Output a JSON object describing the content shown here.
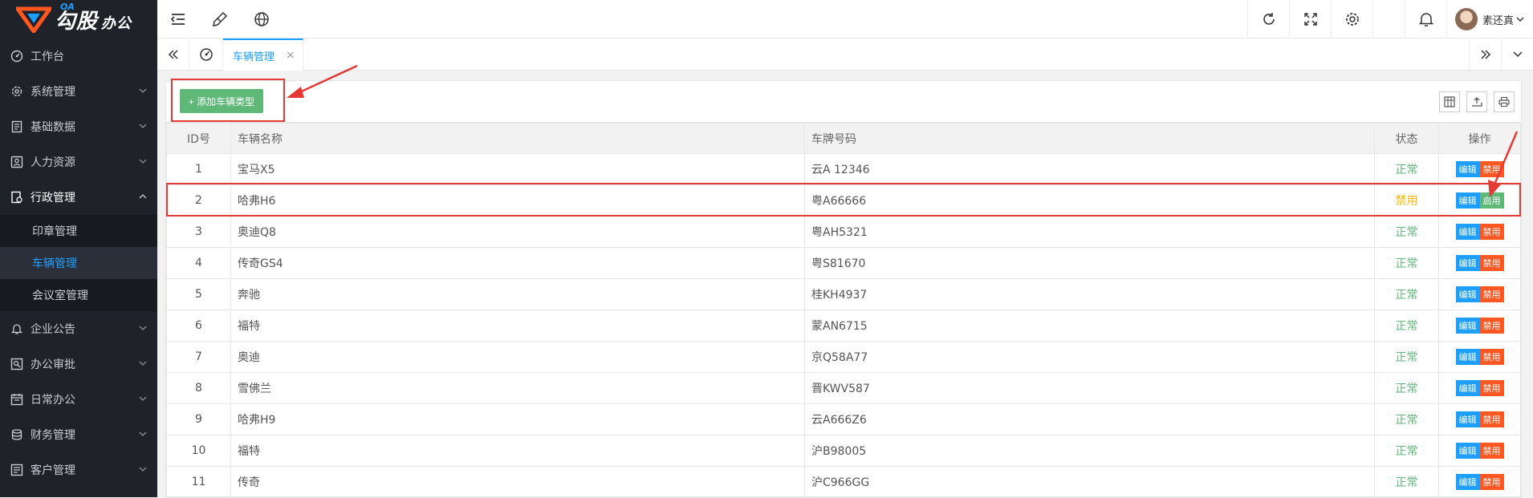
{
  "brand": {
    "oa": "OA",
    "name": "勾股",
    "suffix": "办公"
  },
  "sidebar": {
    "items": [
      {
        "label": "工作台",
        "icon": "dashboard-icon",
        "chevron": false
      },
      {
        "label": "系统管理",
        "icon": "settings-icon",
        "chevron": true
      },
      {
        "label": "基础数据",
        "icon": "database-icon",
        "chevron": true
      },
      {
        "label": "人力资源",
        "icon": "person-icon",
        "chevron": true
      },
      {
        "label": "行政管理",
        "icon": "admin-icon",
        "chevron": true,
        "open": true
      }
    ],
    "sub_items": [
      {
        "label": "印章管理"
      },
      {
        "label": "车辆管理",
        "active": true
      },
      {
        "label": "会议室管理"
      }
    ],
    "items_after": [
      {
        "label": "企业公告",
        "icon": "bell-icon"
      },
      {
        "label": "办公审批",
        "icon": "approval-icon"
      },
      {
        "label": "日常办公",
        "icon": "calendar-icon"
      },
      {
        "label": "财务管理",
        "icon": "finance-icon"
      },
      {
        "label": "客户管理",
        "icon": "customer-icon"
      }
    ]
  },
  "topbar": {
    "user_name": "素还真"
  },
  "tabs": {
    "active_label": "车辆管理",
    "close": "×"
  },
  "toolbar": {
    "add_label": "+ 添加车辆类型"
  },
  "table": {
    "headers": [
      "ID号",
      "车辆名称",
      "车牌号码",
      "状态",
      "操作"
    ],
    "rows": [
      {
        "id": "1",
        "name": "宝马X5",
        "plate": "云A 12346",
        "status": "正常",
        "ops": [
          "编辑",
          "禁用"
        ]
      },
      {
        "id": "2",
        "name": "哈弗H6",
        "plate": "粤A66666",
        "status": "禁用",
        "ops": [
          "编辑",
          "启用"
        ]
      },
      {
        "id": "3",
        "name": "奥迪Q8",
        "plate": "粤AH5321",
        "status": "正常",
        "ops": [
          "编辑",
          "禁用"
        ]
      },
      {
        "id": "4",
        "name": "传奇GS4",
        "plate": "粤S81670",
        "status": "正常",
        "ops": [
          "编辑",
          "禁用"
        ]
      },
      {
        "id": "5",
        "name": "奔驰",
        "plate": "桂KH4937",
        "status": "正常",
        "ops": [
          "编辑",
          "禁用"
        ]
      },
      {
        "id": "6",
        "name": "福特",
        "plate": "蒙AN6715",
        "status": "正常",
        "ops": [
          "编辑",
          "禁用"
        ]
      },
      {
        "id": "7",
        "name": "奥迪",
        "plate": "京Q58A77",
        "status": "正常",
        "ops": [
          "编辑",
          "禁用"
        ]
      },
      {
        "id": "8",
        "name": "雪佛兰",
        "plate": "晋KWV587",
        "status": "正常",
        "ops": [
          "编辑",
          "禁用"
        ]
      },
      {
        "id": "9",
        "name": "哈弗H9",
        "plate": "云A666Z6",
        "status": "正常",
        "ops": [
          "编辑",
          "禁用"
        ]
      },
      {
        "id": "10",
        "name": "福特",
        "plate": "沪B98005",
        "status": "正常",
        "ops": [
          "编辑",
          "禁用"
        ]
      },
      {
        "id": "11",
        "name": "传奇",
        "plate": "沪C966GG",
        "status": "正常",
        "ops": [
          "编辑",
          "禁用"
        ]
      }
    ]
  },
  "colors": {
    "accent": "#1e9fff",
    "success": "#5fb878",
    "warning": "#ffb800",
    "danger": "#ff5722",
    "sidebar_bg": "#20222a",
    "annotation": "#e53935"
  }
}
